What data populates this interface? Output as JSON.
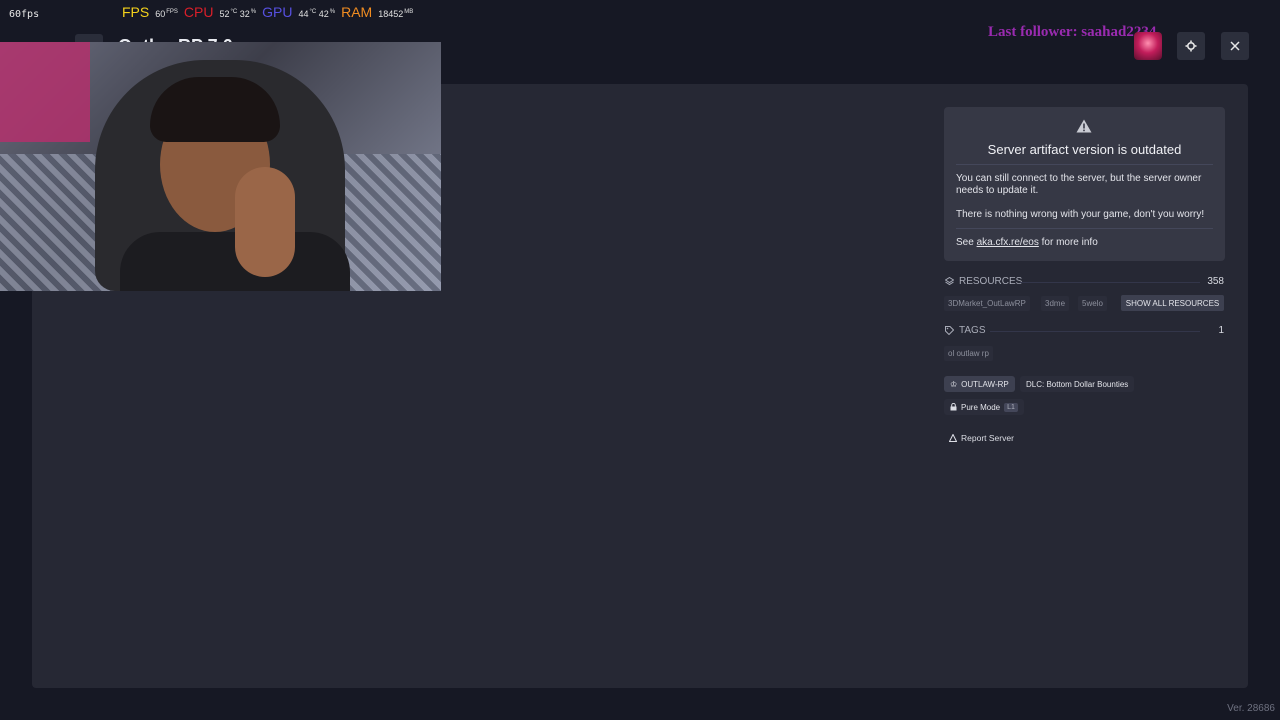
{
  "overlay": {
    "corner_fps": "60fps",
    "stats": [
      {
        "label": "FPS",
        "value": "60",
        "unit": "FPS",
        "color": "#f5d21b"
      },
      {
        "label": "CPU",
        "value": "52",
        "unit": "°C",
        "value2": "32",
        "unit2": "%",
        "color": "#d91f2a"
      },
      {
        "label": "GPU",
        "value": "44",
        "unit": "°C",
        "value2": "42",
        "unit2": "%",
        "color": "#5750e0"
      },
      {
        "label": "RAM",
        "value": "18452",
        "unit": "MB",
        "color": "#f08c21"
      }
    ],
    "last_follower": "Last follower: saahad2234"
  },
  "header": {
    "title": "OutlawRP 7.0",
    "settings_icon": "gear-icon",
    "close_icon": "close-icon"
  },
  "warning": {
    "icon": "warning-triangle-icon",
    "title": "Server artifact version is outdated",
    "p1": "You can still connect to the server, but the server owner needs to update it.",
    "p2": "There is nothing wrong with your game, don't you worry!",
    "p3_prefix": "See ",
    "p3_link": "aka.cfx.re/eos",
    "p3_suffix": " for more info"
  },
  "resources": {
    "label": "RESOURCES",
    "count": "358",
    "chips": [
      "3DMarket_OutLawRP",
      "3dme",
      "5welo"
    ],
    "show_all": "SHOW ALL RESOURCES"
  },
  "tags": {
    "label": "TAGS",
    "count": "1",
    "chips": [
      "ol outlaw rp"
    ]
  },
  "badges": {
    "outlaw": "OUTLAW-RP",
    "dlc": "DLC: Bottom Dollar Bounties",
    "pure_mode": "Pure Mode",
    "pure_level": "L1"
  },
  "report": "Report Server",
  "version": "Ver. 28686",
  "colors": {
    "background": "#161824",
    "panel": "#262834",
    "card": "#363845",
    "follower": "#9a2bb0"
  }
}
